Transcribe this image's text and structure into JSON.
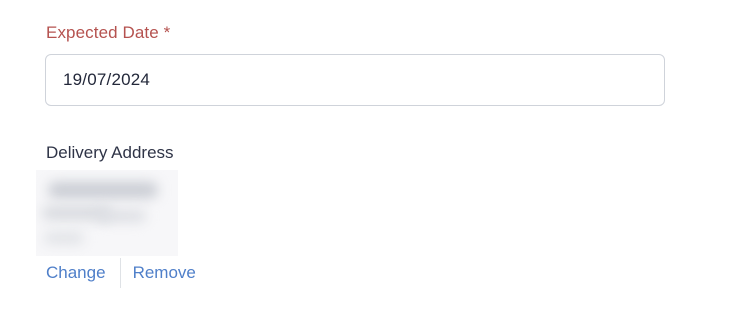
{
  "form": {
    "expected_date_label": "Expected Date *",
    "expected_date_value": "19/07/2024",
    "delivery_address_label": "Delivery Address",
    "actions": {
      "change_label": "Change",
      "remove_label": "Remove"
    }
  },
  "colors": {
    "required_label": "#b5524f",
    "link": "#4f7fc9",
    "text": "#2f3447",
    "input_border": "#cfd3da"
  }
}
